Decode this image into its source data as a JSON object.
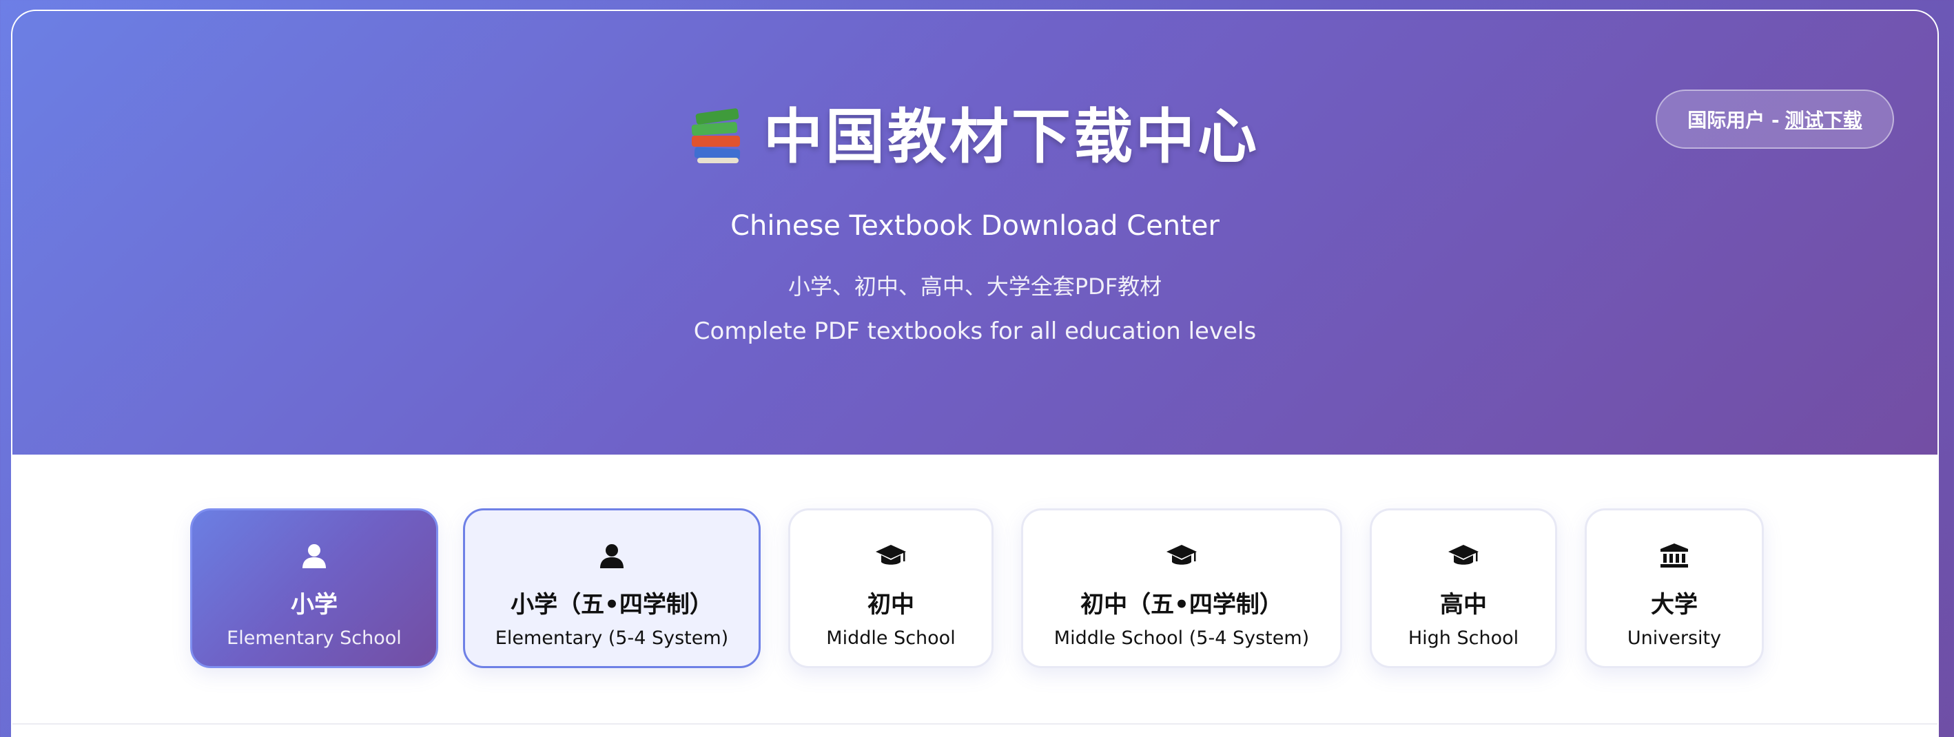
{
  "header": {
    "title": "中国教材下载中心",
    "books_icon": "books-emoji-icon",
    "subtitle_en": "Chinese Textbook Download Center",
    "desc_cn": "小学、初中、高中、大学全套PDF教材",
    "desc_en": "Complete PDF textbooks for all education levels"
  },
  "intl_button": {
    "prefix": "国际用户 - ",
    "link_label": "测试下载"
  },
  "tabs": [
    {
      "cn": "小学",
      "en": "Elementary School",
      "icon": "user-icon",
      "state": "active"
    },
    {
      "cn": "小学（五•四学制）",
      "en": "Elementary (5-4 System)",
      "icon": "user-icon",
      "state": "hovered"
    },
    {
      "cn": "初中",
      "en": "Middle School",
      "icon": "graduation-cap-icon",
      "state": "default"
    },
    {
      "cn": "初中（五•四学制）",
      "en": "Middle School (5-4 System)",
      "icon": "graduation-cap-icon",
      "state": "default"
    },
    {
      "cn": "高中",
      "en": "High School",
      "icon": "graduation-cap-icon",
      "state": "default"
    },
    {
      "cn": "大学",
      "en": "University",
      "icon": "university-icon",
      "state": "default"
    }
  ],
  "colors": {
    "gradient_start": "#6c7fe4",
    "gradient_end": "#734ea4",
    "tab_border": "#e8e9f5",
    "tab_hover_bg": "#eff1fe"
  }
}
